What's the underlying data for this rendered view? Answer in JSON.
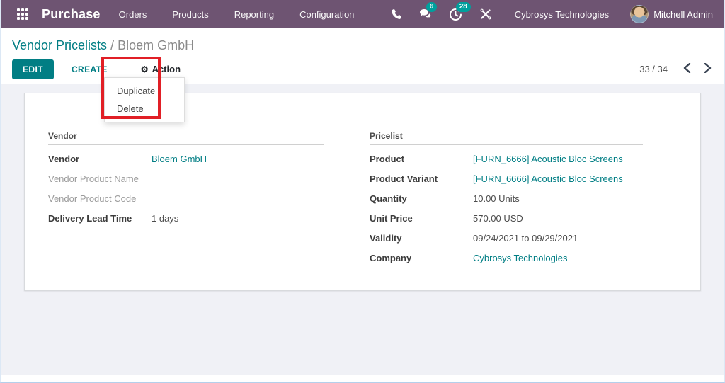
{
  "colors": {
    "navbar": "#6e5472",
    "primary_teal": "#017e84",
    "badge_teal": "#00a09d",
    "highlight_red": "#e11f26",
    "content_bg": "#f0f1f6"
  },
  "topnav": {
    "app_name": "Purchase",
    "menus": [
      "Orders",
      "Products",
      "Reporting",
      "Configuration"
    ],
    "messages_badge": "6",
    "activities_badge": "28",
    "company": "Cybrosys Technologies",
    "user": "Mitchell Admin"
  },
  "breadcrumb": {
    "parent": "Vendor Pricelists",
    "separator": "/",
    "current": "Bloem GmbH"
  },
  "controls": {
    "edit_label": "EDIT",
    "create_label": "CREATE",
    "action_label": "Action",
    "gear_glyph": "⚙"
  },
  "action_menu": {
    "items": [
      "Duplicate",
      "Delete"
    ]
  },
  "pager": {
    "count": "33 / 34"
  },
  "form": {
    "groups": [
      {
        "title": "Vendor",
        "rows": [
          {
            "label": "Vendor",
            "value": "Bloem GmbH"
          },
          {
            "label": "Vendor Product Name",
            "value": ""
          },
          {
            "label": "Vendor Product Code",
            "value": ""
          },
          {
            "label": "Delivery Lead Time",
            "value": "1 days"
          }
        ]
      },
      {
        "title": "Pricelist",
        "rows": [
          {
            "label": "Product",
            "value": "[FURN_6666] Acoustic Bloc Screens"
          },
          {
            "label": "Product Variant",
            "value": "[FURN_6666] Acoustic Bloc Screens"
          },
          {
            "label": "Quantity",
            "value": "10.00 Units"
          },
          {
            "label": "Unit Price",
            "value": "570.00 USD"
          },
          {
            "label": "Validity",
            "value": "09/24/2021 to 09/29/2021"
          },
          {
            "label": "Company",
            "value": "Cybrosys Technologies"
          }
        ]
      }
    ]
  }
}
